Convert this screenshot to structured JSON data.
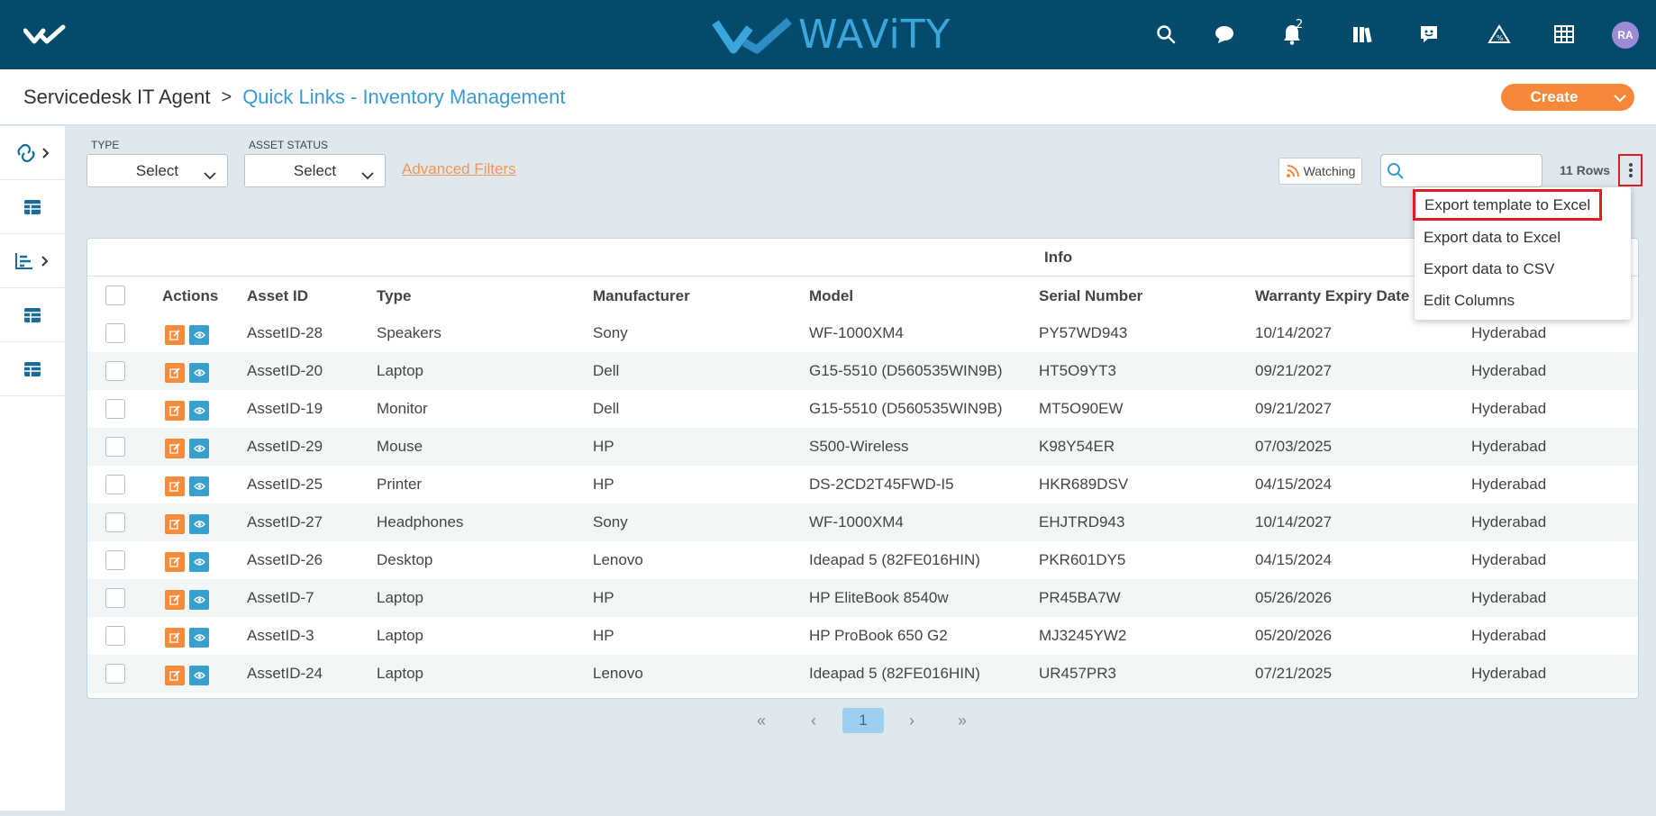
{
  "header": {
    "brand_mark_icon": "wavity-check-icon",
    "logo_text": "WAViTY",
    "notification_count": "2",
    "icons": [
      "search-icon",
      "chat-icon",
      "bell-icon",
      "library-icon",
      "feedback-icon",
      "triangle-sla-icon",
      "apps-grid-icon"
    ],
    "avatar_initials": "RA",
    "bg_color": "#044a6b",
    "accent_color": "#3ba6dc"
  },
  "breadcrumb": {
    "root": "Servicedesk IT Agent",
    "separator": ">",
    "current": "Quick Links - Inventory Management"
  },
  "create_button": {
    "label": "Create",
    "color": "#f7883a"
  },
  "sidebar": {
    "items": [
      {
        "icon": "link-icon",
        "expandable": true
      },
      {
        "icon": "table-icon",
        "expandable": false
      },
      {
        "icon": "chart-icon",
        "expandable": true
      },
      {
        "icon": "table-icon",
        "expandable": false
      },
      {
        "icon": "table-icon",
        "expandable": false
      }
    ]
  },
  "filters": {
    "type_label": "TYPE",
    "type_value": "Select",
    "status_label": "ASSET STATUS",
    "status_value": "Select",
    "advanced": "Advanced Filters"
  },
  "toolbar": {
    "watching_label": "Watching",
    "search_placeholder": "",
    "rows_count": "11 Rows"
  },
  "menu": {
    "items": [
      "Export template to Excel",
      "Export data to Excel",
      "Export data to CSV",
      "Edit Columns"
    ],
    "highlighted_index": 0
  },
  "table": {
    "group_header": "Info",
    "columns": [
      "Actions",
      "Asset ID",
      "Type",
      "Manufacturer",
      "Model",
      "Serial Number",
      "Warranty Expiry Date"
    ],
    "rows": [
      {
        "asset_id": "AssetID-28",
        "type": "Speakers",
        "manufacturer": "Sony",
        "model": "WF-1000XM4",
        "serial": "PY57WD943",
        "warranty": "10/14/2027",
        "location": "Hyderabad"
      },
      {
        "asset_id": "AssetID-20",
        "type": "Laptop",
        "manufacturer": "Dell",
        "model": "G15-5510 (D560535WIN9B)",
        "serial": "HT5O9YT3",
        "warranty": "09/21/2027",
        "location": "Hyderabad"
      },
      {
        "asset_id": "AssetID-19",
        "type": "Monitor",
        "manufacturer": "Dell",
        "model": "G15-5510 (D560535WIN9B)",
        "serial": "MT5O90EW",
        "warranty": "09/21/2027",
        "location": "Hyderabad"
      },
      {
        "asset_id": "AssetID-29",
        "type": "Mouse",
        "manufacturer": "HP",
        "model": "S500-Wireless",
        "serial": "K98Y54ER",
        "warranty": "07/03/2025",
        "location": "Hyderabad"
      },
      {
        "asset_id": "AssetID-25",
        "type": "Printer",
        "manufacturer": "HP",
        "model": "DS-2CD2T45FWD-I5",
        "serial": "HKR689DSV",
        "warranty": "04/15/2024",
        "location": "Hyderabad"
      },
      {
        "asset_id": "AssetID-27",
        "type": "Headphones",
        "manufacturer": "Sony",
        "model": "WF-1000XM4",
        "serial": "EHJTRD943",
        "warranty": "10/14/2027",
        "location": "Hyderabad"
      },
      {
        "asset_id": "AssetID-26",
        "type": "Desktop",
        "manufacturer": "Lenovo",
        "model": "Ideapad 5 (82FE016HIN)",
        "serial": "PKR601DY5",
        "warranty": "04/15/2024",
        "location": "Hyderabad"
      },
      {
        "asset_id": "AssetID-7",
        "type": "Laptop",
        "manufacturer": "HP",
        "model": "HP EliteBook 8540w",
        "serial": "PR45BA7W",
        "warranty": "05/26/2026",
        "location": "Hyderabad"
      },
      {
        "asset_id": "AssetID-3",
        "type": "Laptop",
        "manufacturer": "HP",
        "model": "HP ProBook 650 G2",
        "serial": "MJ3245YW2",
        "warranty": "05/20/2026",
        "location": "Hyderabad"
      },
      {
        "asset_id": "AssetID-24",
        "type": "Laptop",
        "manufacturer": "Lenovo",
        "model": "Ideapad 5 (82FE016HIN)",
        "serial": "UR457PR3",
        "warranty": "07/21/2025",
        "location": "Hyderabad"
      }
    ]
  },
  "pagination": {
    "first": "«",
    "prev": "‹",
    "current": "1",
    "next": "›",
    "last": "»"
  }
}
